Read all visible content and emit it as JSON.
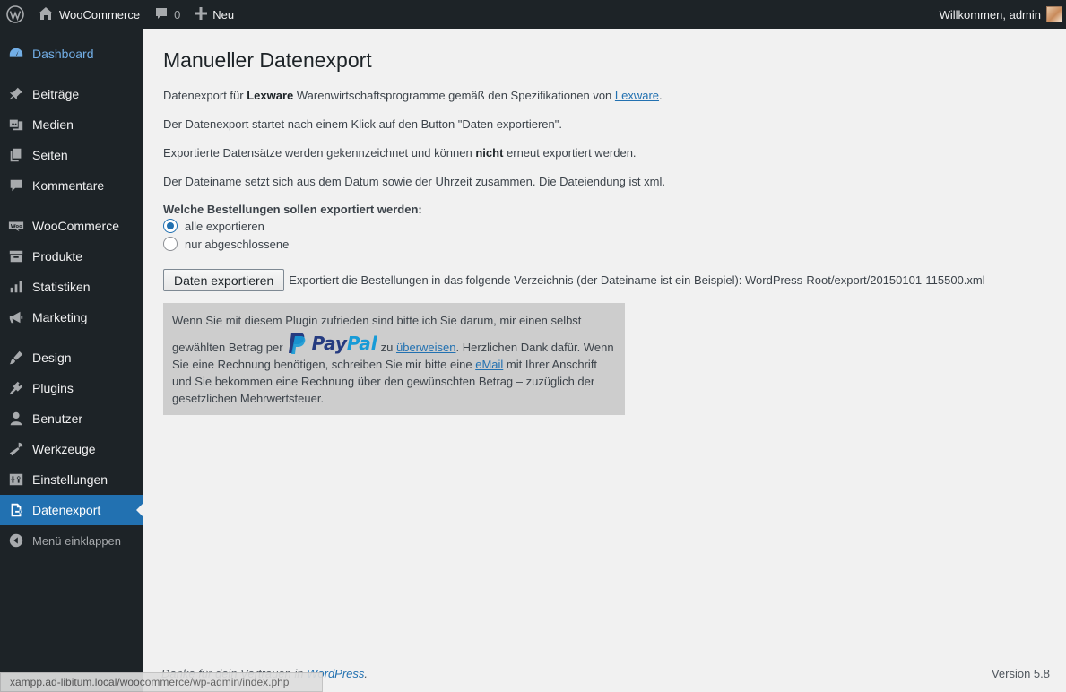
{
  "adminbar": {
    "site_name": "WooCommerce",
    "comments_count": "0",
    "new_label": "Neu",
    "greeting": "Willkommen, admin"
  },
  "sidebar": {
    "items": [
      {
        "label": "Dashboard",
        "icon": "dashboard-icon"
      },
      {
        "label": "Beiträge",
        "icon": "pin-icon"
      },
      {
        "label": "Medien",
        "icon": "media-icon"
      },
      {
        "label": "Seiten",
        "icon": "pages-icon"
      },
      {
        "label": "Kommentare",
        "icon": "comment-icon"
      },
      {
        "label": "WooCommerce",
        "icon": "woo-icon"
      },
      {
        "label": "Produkte",
        "icon": "archive-icon"
      },
      {
        "label": "Statistiken",
        "icon": "chart-bar-icon"
      },
      {
        "label": "Marketing",
        "icon": "megaphone-icon"
      },
      {
        "label": "Design",
        "icon": "brush-icon"
      },
      {
        "label": "Plugins",
        "icon": "plugin-icon"
      },
      {
        "label": "Benutzer",
        "icon": "user-icon"
      },
      {
        "label": "Werkzeuge",
        "icon": "wrench-icon"
      },
      {
        "label": "Einstellungen",
        "icon": "settings-icon"
      },
      {
        "label": "Datenexport",
        "icon": "export-icon"
      }
    ],
    "collapse_label": "Menü einklappen"
  },
  "page": {
    "title": "Manueller Datenexport",
    "p1_pre": "Datenexport für ",
    "p1_bold": "Lexware",
    "p1_mid": " Warenwirtschaftsprogramme gemäß den Spezifikationen von ",
    "p1_link": "Lexware",
    "p1_post": ".",
    "p2": "Der Datenexport startet nach einem Klick auf den Button \"Daten exportieren\".",
    "p3_pre": "Exportierte Datensätze werden gekennzeichnet und können ",
    "p3_bold": "nicht",
    "p3_post": " erneut exportiert werden.",
    "p4": "Der Dateiname setzt sich aus dem Datum sowie der Uhrzeit zusammen. Die Dateiendung ist xml.",
    "question": "Welche Bestellungen sollen exportiert werden:",
    "options": [
      "alle exportieren",
      "nur abgeschlossene"
    ],
    "selected_option": "alle exportieren",
    "export_button": "Daten exportieren",
    "export_note": "Exportiert die Bestellungen in das folgende Verzeichnis (der Dateiname ist ein Beispiel): WordPress-Root/export/20150101-115500.xml"
  },
  "donate": {
    "line1": "Wenn Sie mit diesem Plugin zufrieden sind bitte ich Sie darum, mir einen selbst",
    "line2_pre": "gewählten Betrag per",
    "paypal_pay": "Pay",
    "paypal_pal": "Pal",
    "line2_zu": "zu",
    "link_transfer": "überweisen",
    "line2_post": ". Herzlichen Dank dafür. Wenn",
    "line3_pre": "Sie eine Rechnung benötigen, schreiben Sie mir bitte eine ",
    "link_email": "eMail",
    "line3_post": " mit Ihrer Anschrift",
    "line4": "und Sie bekommen eine Rechnung über den gewünschten Betrag – zuzüglich der",
    "line5": "gesetzlichen Mehrwertsteuer."
  },
  "footer": {
    "thanks_pre": "Danke für dein Vertrauen in ",
    "thanks_link": "WordPress",
    "thanks_post": ".",
    "version": "Version 5.8"
  },
  "statusbar": {
    "url": "xampp.ad-libitum.local/woocommerce/wp-admin/index.php"
  },
  "colors": {
    "sidebar_bg": "#1d2327",
    "accent": "#2271b1",
    "content_bg": "#f1f1f1",
    "donate_bg": "#cdcdcd"
  }
}
